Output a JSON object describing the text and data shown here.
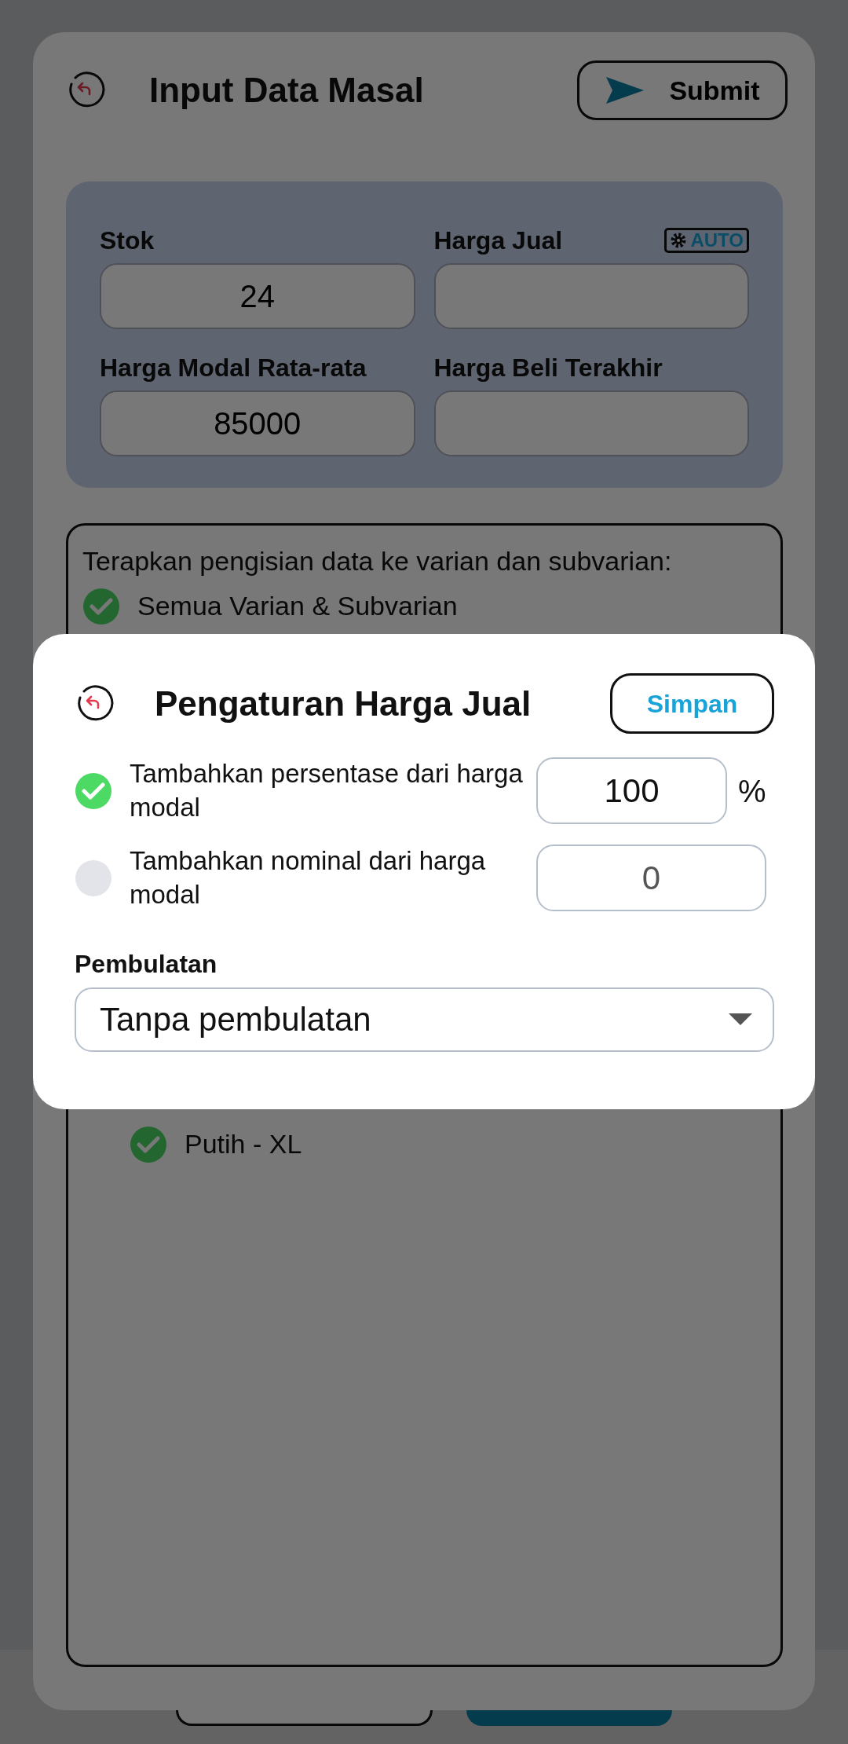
{
  "header": {
    "title": "Input Data Masal",
    "submit_label": "Submit"
  },
  "price_panel": {
    "fields": [
      {
        "label": "Stok",
        "value": "24"
      },
      {
        "label": "Harga Jual",
        "badge": "AUTO"
      },
      {
        "label": "Harga Modal Rata-rata",
        "value": "85000"
      },
      {
        "label": "Harga Beli Terakhir"
      }
    ]
  },
  "apply_box": {
    "prompt": "Terapkan pengisian data ke varian dan subvarian:",
    "items": [
      {
        "label": "Semua Varian & Subvarian",
        "checked": true,
        "kind": "all"
      },
      {
        "label": "Putih - XL",
        "checked": true,
        "kind": "subvariant"
      }
    ]
  },
  "modal": {
    "title": "Pengaturan Harga Jual",
    "save_label": "Simpan",
    "options": [
      {
        "label": "Tambahkan persentase dari harga modal",
        "selected": true,
        "value": "100",
        "unit": "%"
      },
      {
        "label": "Tambahkan nominal dari harga modal",
        "selected": false,
        "value": "0"
      }
    ],
    "rounding": {
      "label": "Pembulatan",
      "value": "Tanpa pembulatan"
    }
  }
}
